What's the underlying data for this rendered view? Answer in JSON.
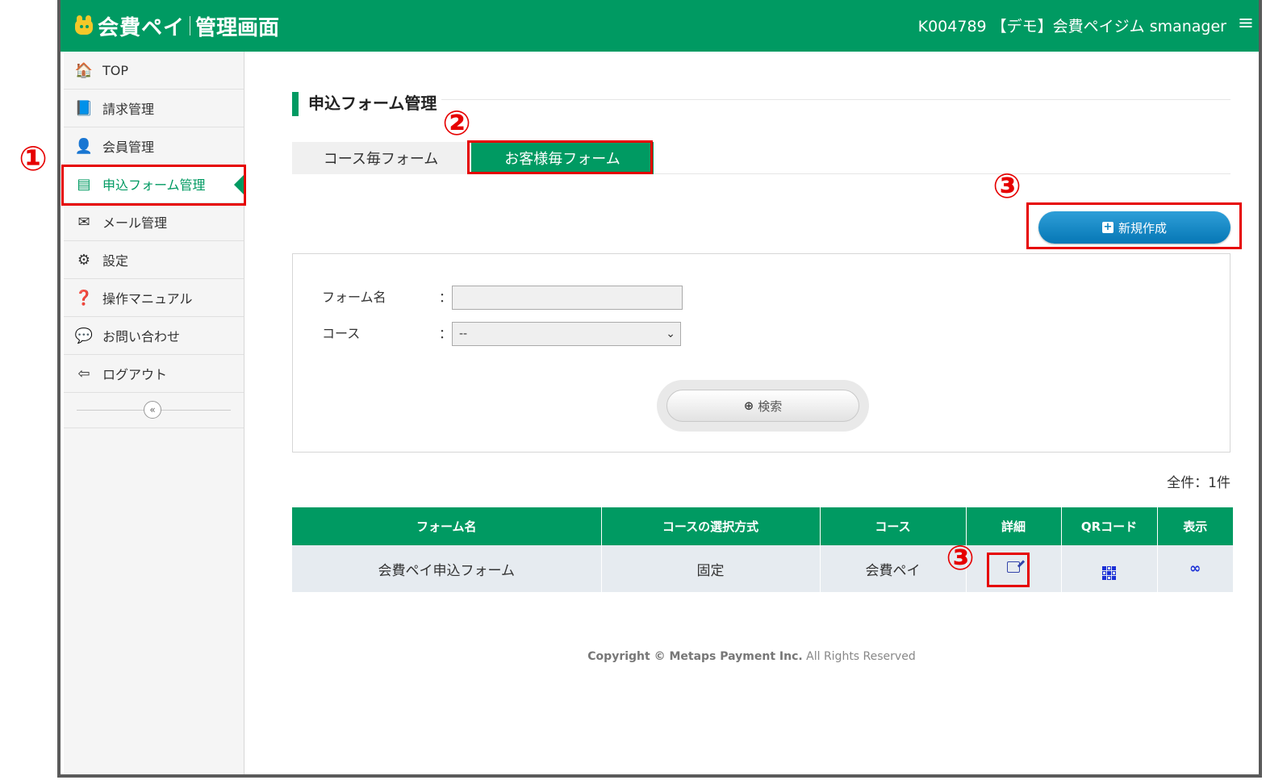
{
  "header": {
    "logo_text": "会費ペイ",
    "logo_sub": "管理画面",
    "user_info": "K004789 【デモ】会費ペイジム smanager",
    "menu_icon": "≡"
  },
  "sidebar": {
    "items": [
      {
        "label": "TOP",
        "icon": "home-icon",
        "glyph": "🏠"
      },
      {
        "label": "請求管理",
        "icon": "book-icon",
        "glyph": "📘"
      },
      {
        "label": "会員管理",
        "icon": "user-icon",
        "glyph": "👤"
      },
      {
        "label": "申込フォーム管理",
        "icon": "list-icon",
        "glyph": "▤"
      },
      {
        "label": "メール管理",
        "icon": "mail-icon",
        "glyph": "✉"
      },
      {
        "label": "設定",
        "icon": "gears-icon",
        "glyph": "⚙"
      },
      {
        "label": "操作マニュアル",
        "icon": "question-icon",
        "glyph": "❓"
      },
      {
        "label": "お問い合わせ",
        "icon": "chat-icon",
        "glyph": "💬"
      },
      {
        "label": "ログアウト",
        "icon": "logout-icon",
        "glyph": "⇦"
      }
    ],
    "collapse_glyph": "«"
  },
  "main": {
    "page_title": "申込フォーム管理",
    "tabs": [
      {
        "label": "コース毎フォーム"
      },
      {
        "label": "お客様毎フォーム"
      }
    ],
    "new_button_label": "新規作成",
    "search": {
      "form_name_label": "フォーム名",
      "course_label": "コース",
      "colon": "：",
      "form_name_value": "",
      "course_selected": "--",
      "search_button_label": "検索"
    },
    "total": "全件：1件",
    "table": {
      "headers": [
        "フォーム名",
        "コースの選択方式",
        "コース",
        "詳細",
        "QRコード",
        "表示"
      ],
      "rows": [
        {
          "form_name": "会費ペイ申込フォーム",
          "method": "固定",
          "course": "会費ペイ"
        }
      ]
    },
    "copyright_bold": "Copyright © Metaps Payment Inc.",
    "copyright_rest": " All Rights Reserved"
  },
  "annotations": {
    "colors": {
      "accent": "#e60000",
      "brand": "#009a62",
      "button_blue": "#0a82c0"
    },
    "numbers": [
      "①",
      "②",
      "③",
      "③"
    ]
  }
}
